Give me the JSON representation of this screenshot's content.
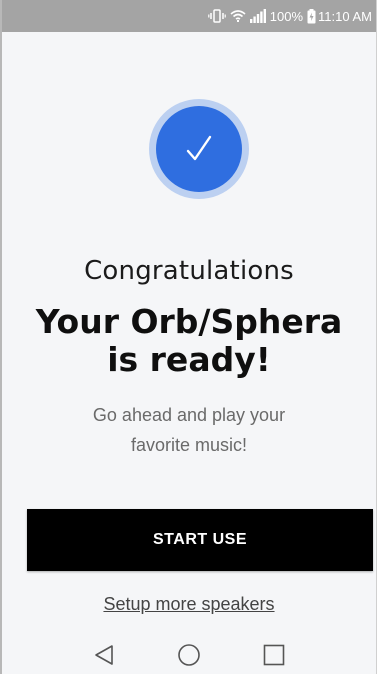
{
  "status_bar": {
    "battery_percent": "100%",
    "time": "11:10 AM",
    "icons": [
      "vibrate-icon",
      "wifi-icon",
      "signal-icon",
      "battery-charging-icon"
    ]
  },
  "success_icon": "checkmark-icon",
  "colors": {
    "accent": "#2f6ee0",
    "accent_halo": "#bcd0f1",
    "button_bg": "#000000",
    "background": "#f5f6f8"
  },
  "main": {
    "congrats": "Congratulations",
    "headline_line1": "Your Orb/Sphera",
    "headline_line2": "is ready!",
    "subtitle_line1": "Go ahead and play your",
    "subtitle_line2": "favorite music!",
    "start_button_label": "START USE",
    "setup_link": "Setup more speakers"
  },
  "nav_bar": {
    "icons": [
      "back-icon",
      "home-icon",
      "recents-icon"
    ]
  }
}
